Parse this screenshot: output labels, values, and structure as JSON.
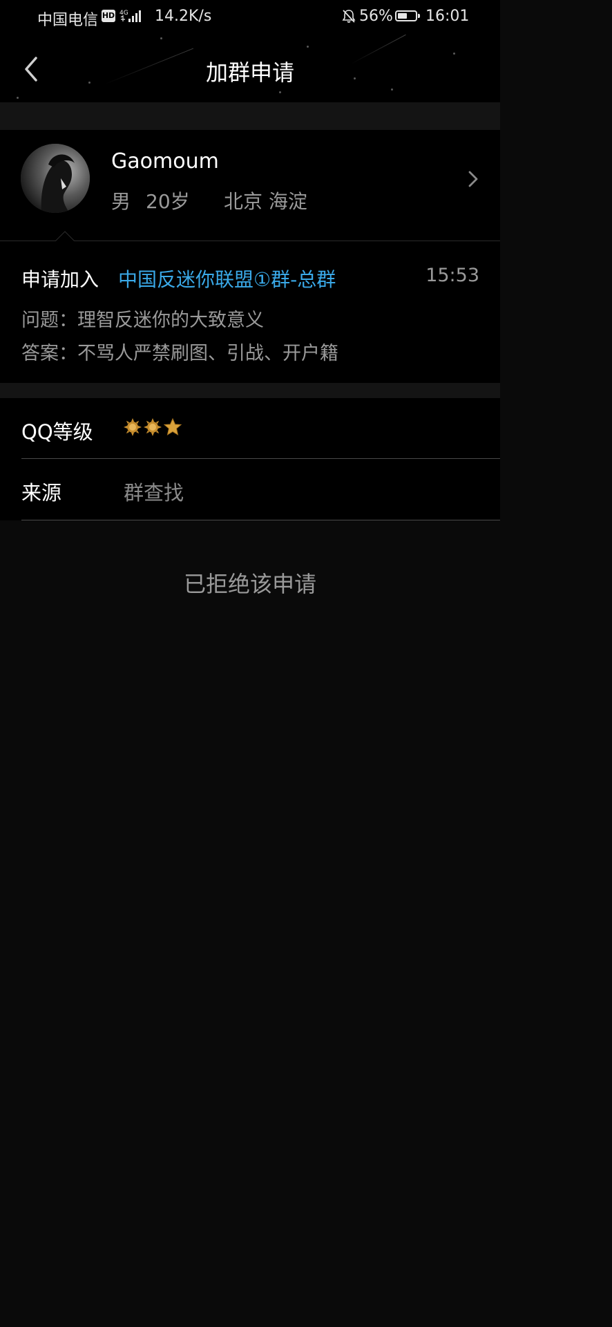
{
  "status_bar": {
    "carrier": "中国电信",
    "hd_badge": "HD",
    "network": "4G",
    "speed": "14.2K/s",
    "battery_percent": "56%",
    "battery_level": 0.56,
    "time": "16:01"
  },
  "header": {
    "title": "加群申请"
  },
  "profile": {
    "name": "Gaomoum",
    "gender": "男",
    "age": "20岁",
    "location": "北京 海淀"
  },
  "request": {
    "label": "申请加入",
    "group_name": "中国反迷你联盟①群-总群",
    "time": "15:53",
    "question": "问题：理智反迷你的大致意义",
    "answer": "答案：不骂人严禁刷图、引战、开户籍"
  },
  "info": {
    "qq_level_label": "QQ等级",
    "qq_level_icons": [
      "sun-icon",
      "sun-icon",
      "star-icon"
    ],
    "source_label": "来源",
    "source_value": "群查找"
  },
  "status_message": "已拒绝该申请",
  "colors": {
    "background": "#0a0a0a",
    "card": "#000000",
    "link": "#3aa9e8",
    "secondary_text": "#9a9a9a",
    "level_gold": "#d9a13a"
  }
}
